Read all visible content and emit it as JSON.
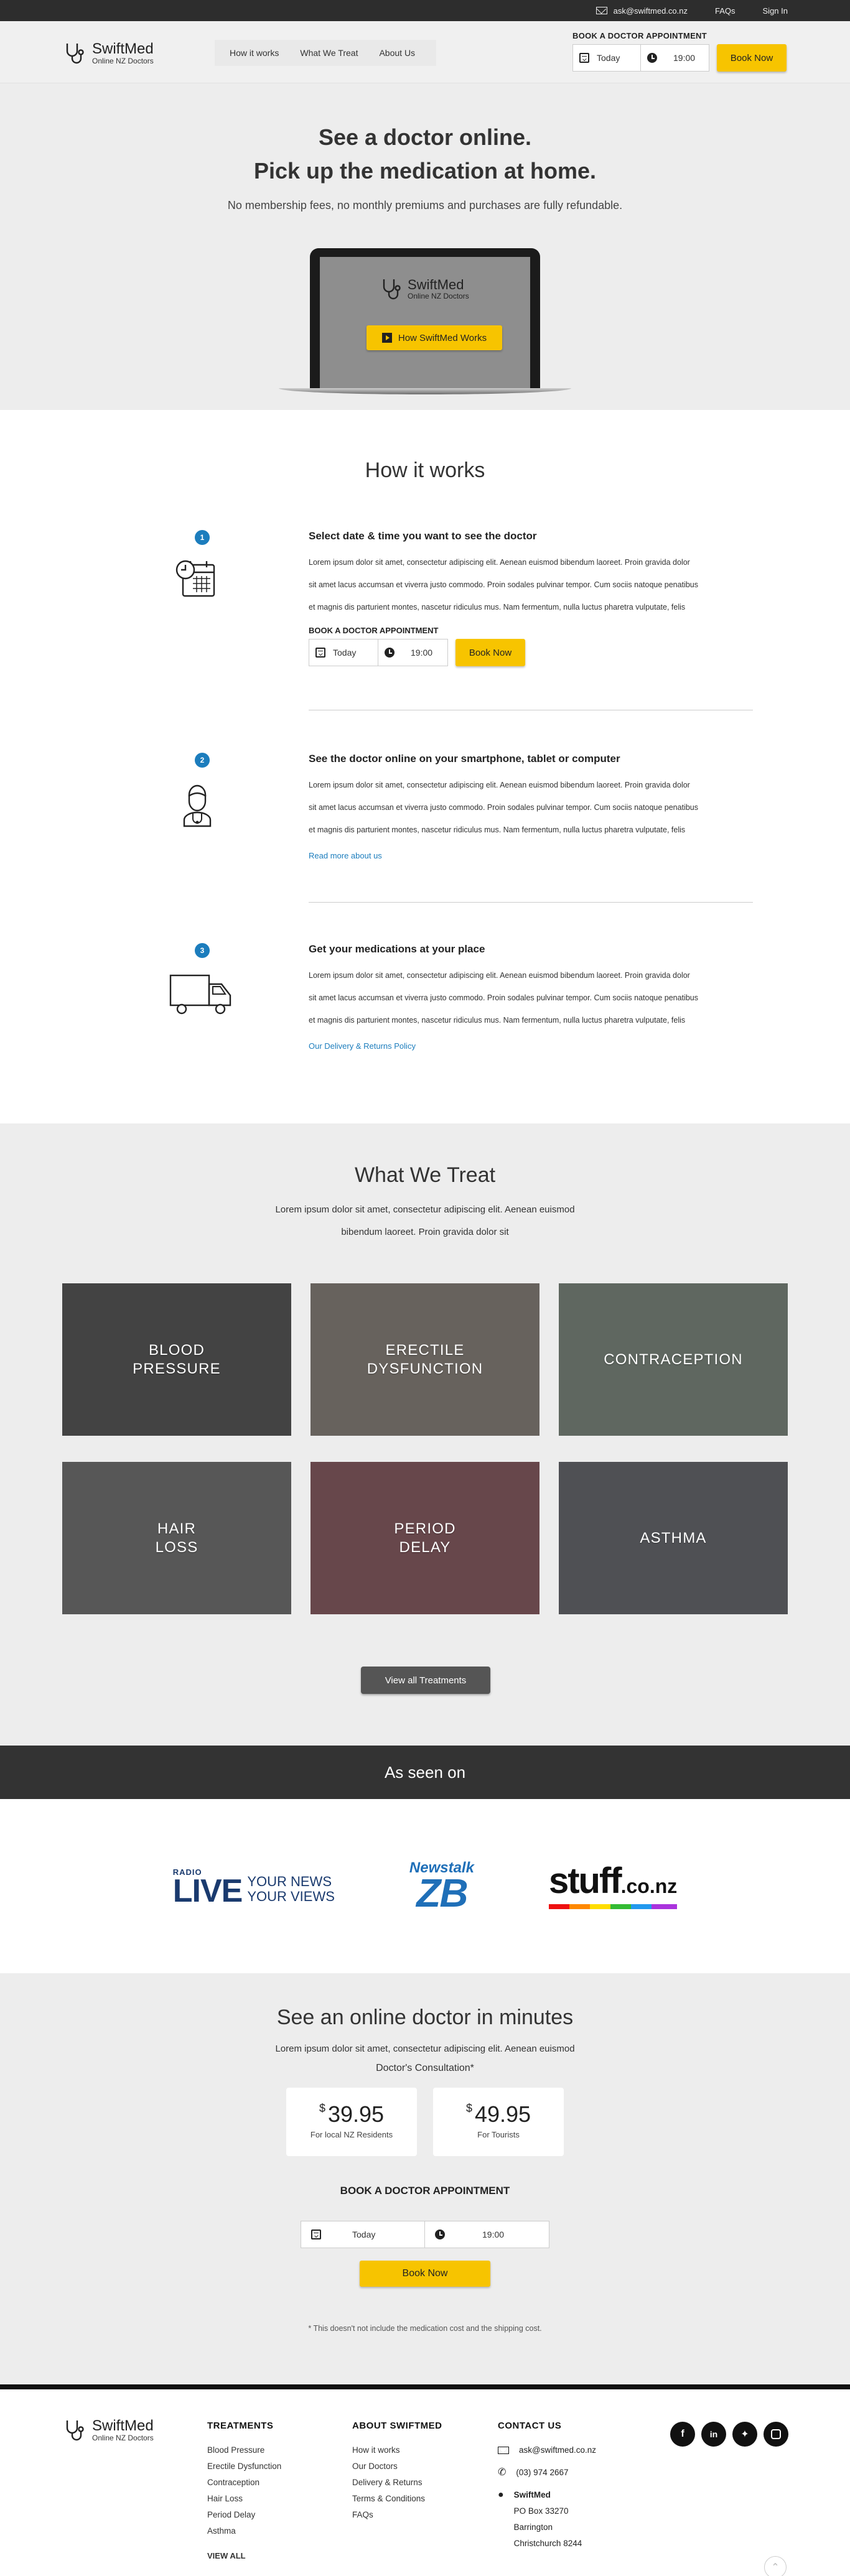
{
  "topbar": {
    "email": "ask@swiftmed.co.nz",
    "faqs": "FAQs",
    "signin": "Sign In"
  },
  "brand": {
    "name": "SwiftMed",
    "tagline": "Online NZ Doctors"
  },
  "nav": [
    "How it works",
    "What We Treat",
    "About Us"
  ],
  "booking": {
    "label": "BOOK A DOCTOR APPOINTMENT",
    "date": "Today",
    "time": "19:00",
    "button": "Book Now"
  },
  "hero": {
    "line1": "See a doctor online.",
    "line2": "Pick up the medication at home.",
    "subtitle": "No membership fees, no monthly premiums and purchases are fully refundable.",
    "video_button": "How SwiftMed Works"
  },
  "how": {
    "title": "How it works",
    "steps": [
      {
        "num": "1",
        "title": "Select date & time you want to see the doctor",
        "l1": "Lorem ipsum dolor sit amet, consectetur adipiscing elit. Aenean euismod bibendum laoreet. Proin gravida dolor",
        "l2": "sit amet lacus accumsan et viverra justo commodo. Proin sodales pulvinar tempor. Cum sociis natoque penatibus",
        "l3": "et magnis dis parturient montes, nascetur ridiculus mus. Nam fermentum, nulla luctus pharetra vulputate, felis"
      },
      {
        "num": "2",
        "title": "See the doctor online on your smartphone, tablet or computer",
        "l1": "Lorem ipsum dolor sit amet, consectetur adipiscing elit. Aenean euismod bibendum laoreet. Proin gravida dolor",
        "l2": "sit amet lacus accumsan et viverra justo commodo. Proin sodales pulvinar tempor. Cum sociis natoque penatibus",
        "l3": "et magnis dis parturient montes, nascetur ridiculus mus. Nam fermentum, nulla luctus pharetra vulputate, felis",
        "link": "Read more about us"
      },
      {
        "num": "3",
        "title": "Get your medications at your place",
        "l1": "Lorem ipsum dolor sit amet, consectetur adipiscing elit. Aenean euismod bibendum laoreet. Proin gravida dolor",
        "l2": "sit amet lacus accumsan et viverra justo commodo. Proin sodales pulvinar tempor. Cum sociis natoque penatibus",
        "l3": "et magnis dis parturient montes, nascetur ridiculus mus. Nam fermentum, nulla luctus pharetra vulputate, felis",
        "link": "Our Delivery & Returns Policy"
      }
    ]
  },
  "treat": {
    "title": "What We Treat",
    "intro": "Lorem ipsum dolor sit amet, consectetur adipiscing elit. Aenean euismod bibendum laoreet. Proin gravida dolor sit",
    "tiles": [
      {
        "label": "BLOOD\nPRESSURE",
        "color": "#4a4a4a"
      },
      {
        "label": "ERECTILE\nDYSFUNCTION",
        "color": "#8a8178"
      },
      {
        "label": "CONTRACEPTION",
        "color": "#7d8a7e"
      },
      {
        "label": "HAIR\nLOSS",
        "color": "#6e6e6e"
      },
      {
        "label": "PERIOD\nDELAY",
        "color": "#8a5058"
      },
      {
        "label": "ASTHMA",
        "color": "#5f6168"
      }
    ],
    "view_all": "View all Treatments"
  },
  "seen": {
    "title": "As seen on",
    "radio": "RADIO",
    "live": "LIVE",
    "news": "YOUR NEWS",
    "views": "YOUR VIEWS",
    "nt": "Newstalk",
    "zb": "ZB",
    "stuff": "stuff",
    "stuff_tld": ".co.nz"
  },
  "cta": {
    "title": "See an online doctor in minutes",
    "intro": "Lorem ipsum dolor sit amet, consectetur adipiscing elit. Aenean euismod",
    "consult": "Doctor's Consultation*",
    "prices": [
      {
        "currency": "$",
        "amount": "39.95",
        "who": "For local NZ Residents"
      },
      {
        "currency": "$",
        "amount": "49.95",
        "who": "For Tourists"
      }
    ],
    "book_label": "BOOK A DOCTOR APPOINTMENT",
    "date": "Today",
    "time": "19:00",
    "button": "Book Now",
    "note": "* This doesn't not include the medication cost and the shipping cost."
  },
  "footer": {
    "treatments_title": "TREATMENTS",
    "treatments": [
      "Blood Pressure",
      "Erectile Dysfunction",
      "Contraception",
      "Hair Loss",
      "Period Delay",
      "Asthma"
    ],
    "view_all": "VIEW ALL",
    "about_title": "ABOUT SWIFTMED",
    "about": [
      "How it works",
      "Our Doctors",
      "Delivery & Returns",
      "Terms & Conditions",
      "FAQs"
    ],
    "contact_title": "CONTACT US",
    "email": "ask@swiftmed.co.nz",
    "phone": "(03) 974 2667",
    "addr": [
      "SwiftMed",
      "PO Box 33270",
      "Barrington",
      "Christchurch 8244"
    ],
    "social": [
      "facebook-icon",
      "linkedin-icon",
      "twitter-icon",
      "instagram-icon"
    ]
  },
  "colors": {
    "accent": "#f7c400",
    "link": "#1c7dbd",
    "dark": "#2d2d2d"
  }
}
